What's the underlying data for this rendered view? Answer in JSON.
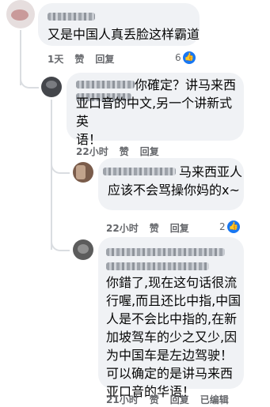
{
  "comments": [
    {
      "text": "又是中国人真丢脸这样霸道",
      "time": "1天",
      "like": "赞",
      "reply": "回复",
      "reactions": "6"
    },
    {
      "text": "你確定？讲马来西\n亚口音的中文,另一个讲新式英\n语！",
      "time": "22小时",
      "like": "赞",
      "reply": "回复"
    },
    {
      "text": "马来西亚人\n应该不会骂操你妈的x~",
      "time": "22小时",
      "like": "赞",
      "reply": "回复",
      "reactions": "2"
    },
    {
      "text": "你錯了,现在这句话很流\n行喔,而且还比中指,中国\n人是不会比中指的,在新\n加坡驾车的少之又少,因\n为中国车是左边驾驶！\n可以确定的是讲马来西\n亚口音的华语！",
      "time": "21小时",
      "like": "赞",
      "reply": "回复",
      "edited": "已编辑"
    }
  ],
  "icons": {
    "like": "thumbs-up-icon"
  },
  "colors": {
    "bubble": "#f0f2f5",
    "like_blue": "#1877f2",
    "meta": "#65676b"
  }
}
